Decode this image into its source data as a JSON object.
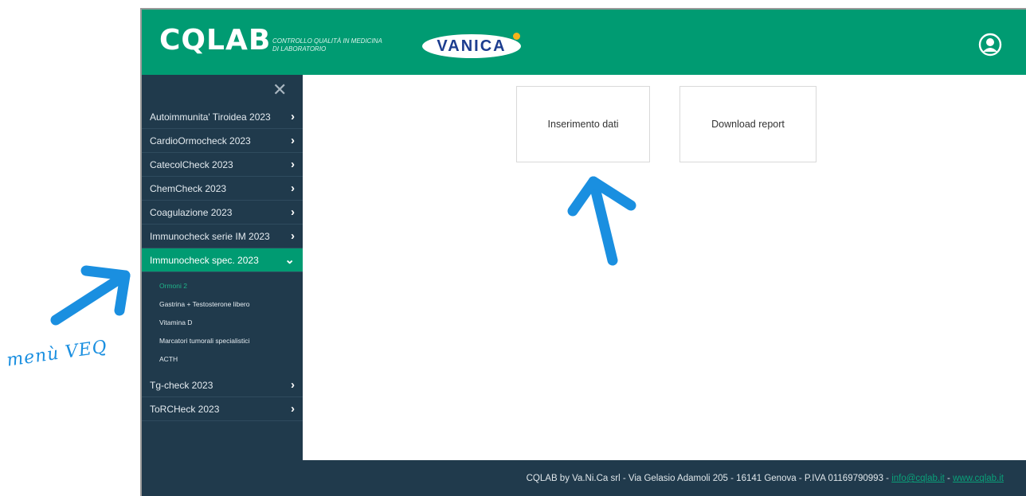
{
  "header": {
    "logo": "CQLAB",
    "tagline_line1": "Controllo qualità in medicina",
    "tagline_line2": "di laboratorio",
    "partner_logo": "VANICA",
    "user_icon": "user-circle-icon",
    "bg_color": "#009b72"
  },
  "sidebar": {
    "close_icon": "close-icon",
    "items": [
      {
        "label": "Autoimmunita' Tiroidea 2023",
        "chevron": "›"
      },
      {
        "label": "CardioOrmocheck 2023",
        "chevron": "›"
      },
      {
        "label": "CatecolCheck 2023",
        "chevron": "›"
      },
      {
        "label": "ChemCheck 2023",
        "chevron": "›"
      },
      {
        "label": "Coagulazione 2023",
        "chevron": "›"
      },
      {
        "label": "Immunocheck serie IM 2023",
        "chevron": "›"
      },
      {
        "label": "Immunocheck spec. 2023",
        "chevron": "⌄",
        "expanded": true,
        "subitems": [
          "Ormoni 2",
          "Gastrina + Testosterone libero",
          "Vitamina D",
          "Marcatori tumorali specialistici",
          "ACTH"
        ]
      },
      {
        "label": "Tg-check 2023",
        "chevron": "›"
      },
      {
        "label": "ToRCHeck 2023",
        "chevron": "›"
      }
    ]
  },
  "main": {
    "cards": [
      "Inserimento dati",
      "Download report"
    ]
  },
  "footer": {
    "text": "CQLAB by Va.Ni.Ca srl - Via Gelasio Adamoli 205 - 16141 Genova - P.IVA 01169790993 - ",
    "email": "info@cqlab.it",
    "separator": " - ",
    "website": "www.cqlab.it"
  },
  "annotation": {
    "handwritten": "menù VEQ",
    "color": "#1a8fe0"
  }
}
